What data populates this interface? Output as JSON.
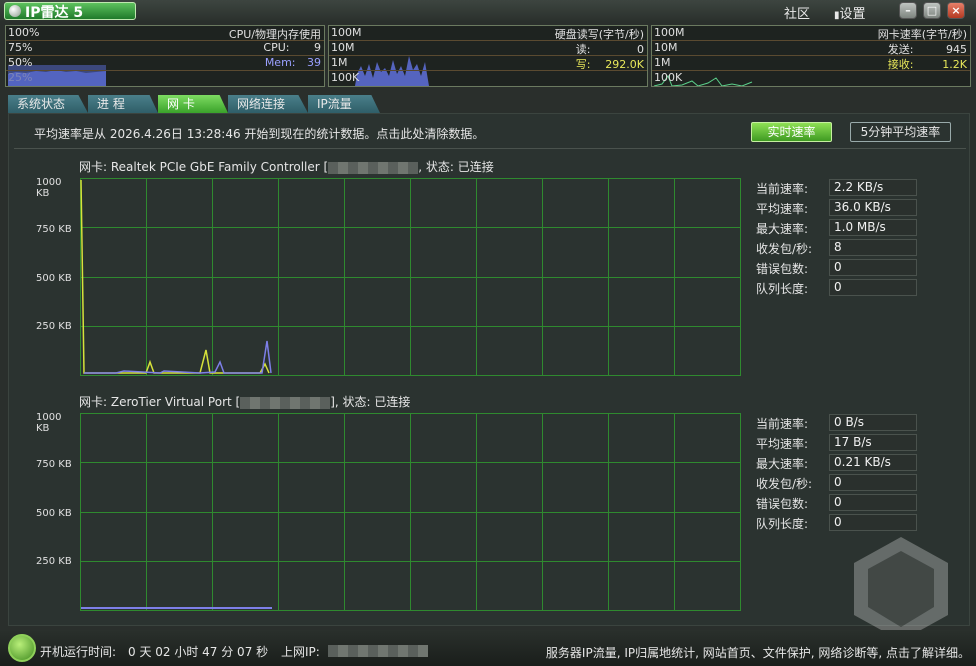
{
  "app": {
    "title": "IP雷达 5",
    "links": [
      "社区",
      "设置"
    ]
  },
  "monitors": {
    "cpu": {
      "title": "CPU/物理内存使用",
      "scale": [
        "100%",
        "75%",
        "50%",
        "25%"
      ],
      "cpu_label": "CPU:",
      "cpu_value": "9",
      "mem_label": "Mem:",
      "mem_value": "39"
    },
    "disk": {
      "title": "硬盘读写(字节/秒)",
      "scale": [
        "100M",
        "10M",
        "1M",
        "100K"
      ],
      "read_label": "读:",
      "read_value": "0",
      "write_label": "写:",
      "write_value": "292.0K"
    },
    "net": {
      "title": "网卡速率(字节/秒)",
      "scale": [
        "100M",
        "10M",
        "1M",
        "100K"
      ],
      "send_label": "发送:",
      "send_value": "945",
      "recv_label": "接收:",
      "recv_value": "1.2K"
    }
  },
  "tabs": [
    "系统状态",
    "进 程",
    "网 卡",
    "网络连接",
    "IP流量"
  ],
  "info": {
    "text": "平均速率是从  2026.4.26日  13:28:46  开始到现在的统计数据。点击此处清除数据。"
  },
  "buttons": {
    "realtime": "实时速率",
    "avg5": "5分钟平均速率"
  },
  "adapters": [
    {
      "prefix": "网卡: Realtek PCIe GbE Family Controller [",
      "suffix": ", 状态: 已连接",
      "yticks": [
        "1000 KB",
        "750 KB",
        "500 KB",
        "250 KB"
      ],
      "stats": [
        {
          "label": "当前速率:",
          "value": "2.2 KB/s"
        },
        {
          "label": "平均速率:",
          "value": "36.0 KB/s"
        },
        {
          "label": "最大速率:",
          "value": "1.0 MB/s"
        },
        {
          "label": "收发包/秒:",
          "value": "8"
        },
        {
          "label": "错误包数:",
          "value": "0"
        },
        {
          "label": "队列长度:",
          "value": "0"
        }
      ]
    },
    {
      "prefix": "网卡: ZeroTier Virtual Port [",
      "suffix": "], 状态: 已连接",
      "yticks": [
        "1000 KB",
        "750 KB",
        "500 KB",
        "250 KB"
      ],
      "stats": [
        {
          "label": "当前速率:",
          "value": "0 B/s"
        },
        {
          "label": "平均速率:",
          "value": "17 B/s"
        },
        {
          "label": "最大速率:",
          "value": "0.21 KB/s"
        },
        {
          "label": "收发包/秒:",
          "value": "0"
        },
        {
          "label": "错误包数:",
          "value": "0"
        },
        {
          "label": "队列长度:",
          "value": "0"
        }
      ]
    }
  ],
  "status": {
    "uptime_label": "开机运行时间:",
    "uptime_value": "0 天 02 小时 47 分 07 秒",
    "ip_label": "上网IP:",
    "right": "服务器IP流量, IP归属地统计, 网站首页、文件保护, 网络诊断等, 点击了解详细。"
  },
  "colors": {
    "accent_green": "#5bbf3a",
    "grid": "#2f8a2f",
    "series_yellow": "#d6e23a",
    "series_blue": "#7d7fe8"
  }
}
